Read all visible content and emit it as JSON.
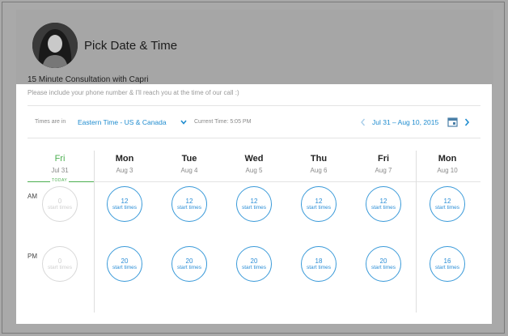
{
  "header": {
    "title": "Pick Date & Time",
    "consultation": "15 Minute Consultation with Capri",
    "note": "Please include your phone number & I'll reach you at the time of our call :)"
  },
  "toolbar": {
    "times_label": "Times are in",
    "timezone": "Eastern Time - US & Canada",
    "current_time": "Current Time: 5:05 PM",
    "date_range": "Jul 31 – Aug 10, 2015"
  },
  "rows": {
    "am": "AM",
    "pm": "PM"
  },
  "today_label": "TODAY",
  "days": [
    {
      "name": "Fri",
      "date": "Jul 31",
      "am": "0",
      "pm": "0",
      "unit": "start times",
      "today": true
    },
    {
      "name": "Mon",
      "date": "Aug 3",
      "am": "12",
      "pm": "20",
      "unit": "start times"
    },
    {
      "name": "Tue",
      "date": "Aug 4",
      "am": "12",
      "pm": "20",
      "unit": "start times"
    },
    {
      "name": "Wed",
      "date": "Aug 5",
      "am": "12",
      "pm": "20",
      "unit": "start times"
    },
    {
      "name": "Thu",
      "date": "Aug 6",
      "am": "12",
      "pm": "18",
      "unit": "start times"
    },
    {
      "name": "Fri",
      "date": "Aug 7",
      "am": "12",
      "pm": "20",
      "unit": "start times"
    },
    {
      "name": "Mon",
      "date": "Aug 10",
      "am": "12",
      "pm": "16",
      "unit": "start times"
    }
  ],
  "colors": {
    "accent": "#1f8ccf",
    "today": "#4caf50",
    "disabled": "#d8d8d8"
  }
}
